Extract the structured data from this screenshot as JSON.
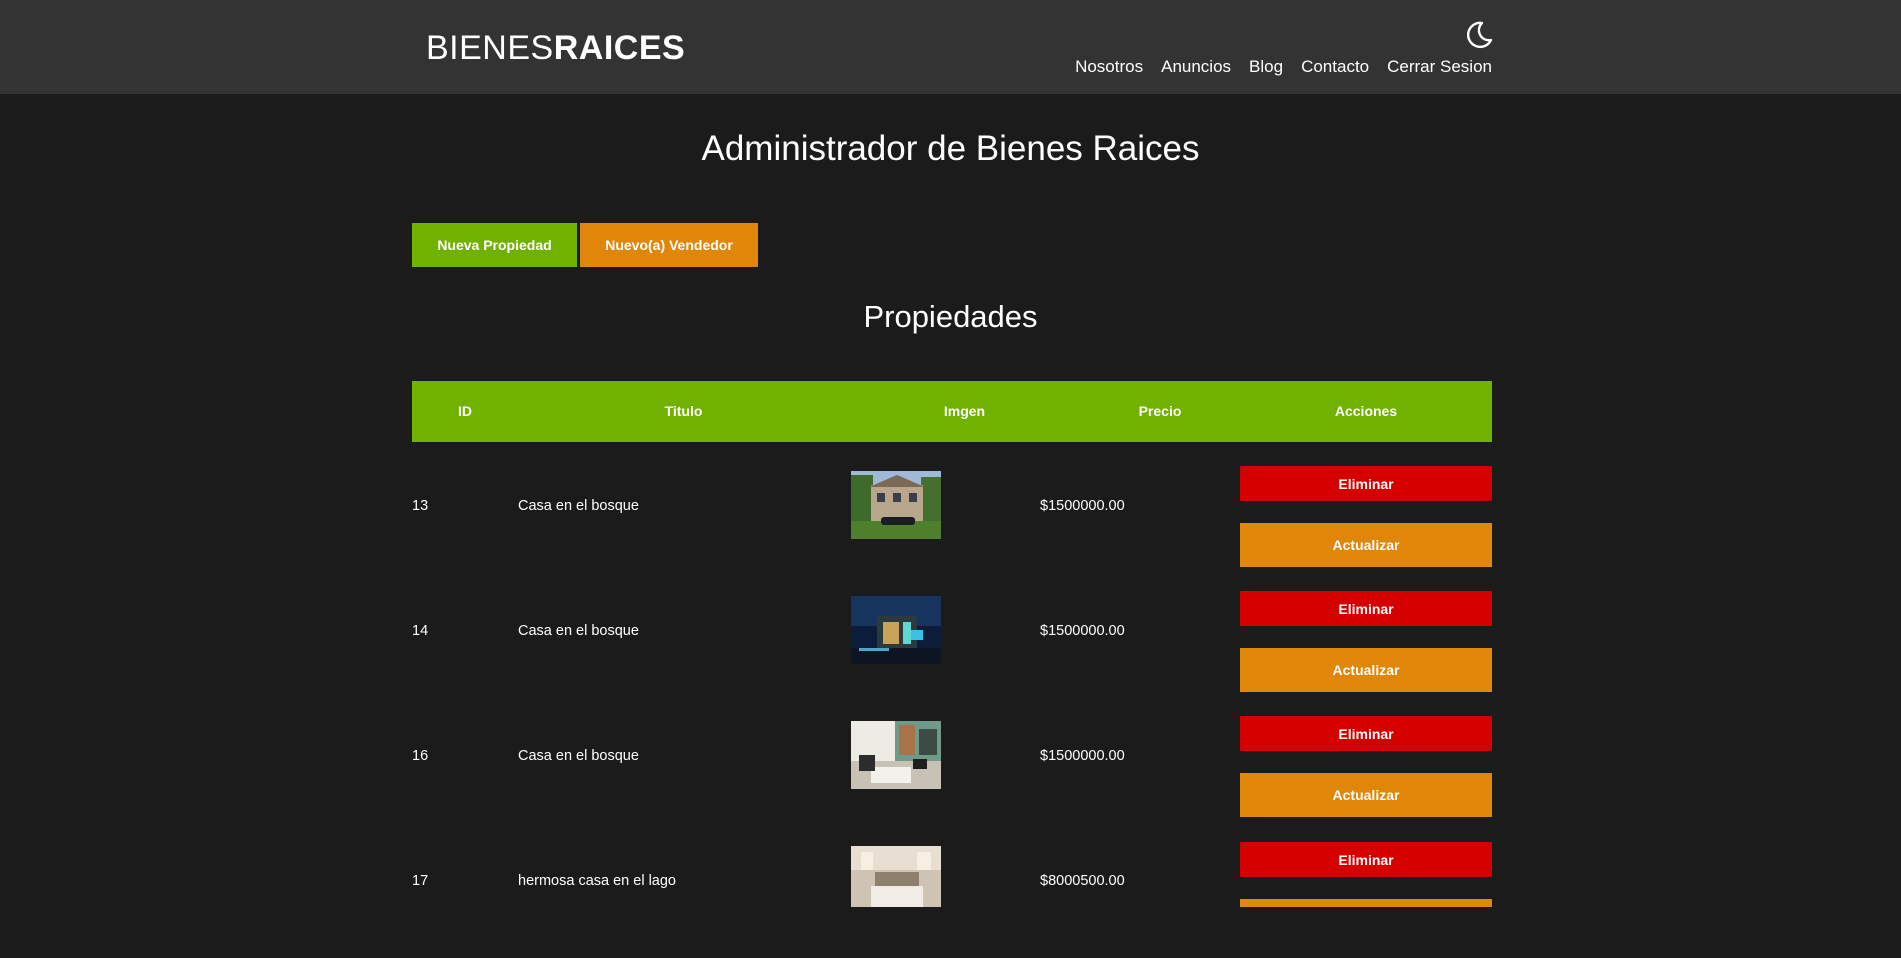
{
  "header": {
    "logo_light": "BIENES",
    "logo_bold": "RAICES",
    "nav": [
      "Nosotros",
      "Anuncios",
      "Blog",
      "Contacto",
      "Cerrar Sesion"
    ]
  },
  "title": "Administrador de Bienes Raices",
  "actions": {
    "new_property": "Nueva Propiedad",
    "new_seller": "Nuevo(a) Vendedor"
  },
  "section_title": "Propiedades",
  "table": {
    "headers": [
      "ID",
      "Titulo",
      "Imgen",
      "Precio",
      "Acciones"
    ],
    "rows": [
      {
        "id": "13",
        "title": "Casa en el bosque",
        "price": "$1500000.00"
      },
      {
        "id": "14",
        "title": "Casa en el bosque",
        "price": "$1500000.00"
      },
      {
        "id": "16",
        "title": "Casa en el bosque",
        "price": "$1500000.00"
      },
      {
        "id": "17",
        "title": "hermosa casa en el lago",
        "price": "$8000500.00"
      }
    ],
    "delete_label": "Eliminar",
    "update_label": "Actualizar"
  },
  "colors": {
    "header_bg": "#333333",
    "page_bg": "#1b1b1b",
    "green": "#71b100",
    "orange": "#e08709",
    "red": "#d40000"
  },
  "icons": [
    "moon-icon"
  ]
}
